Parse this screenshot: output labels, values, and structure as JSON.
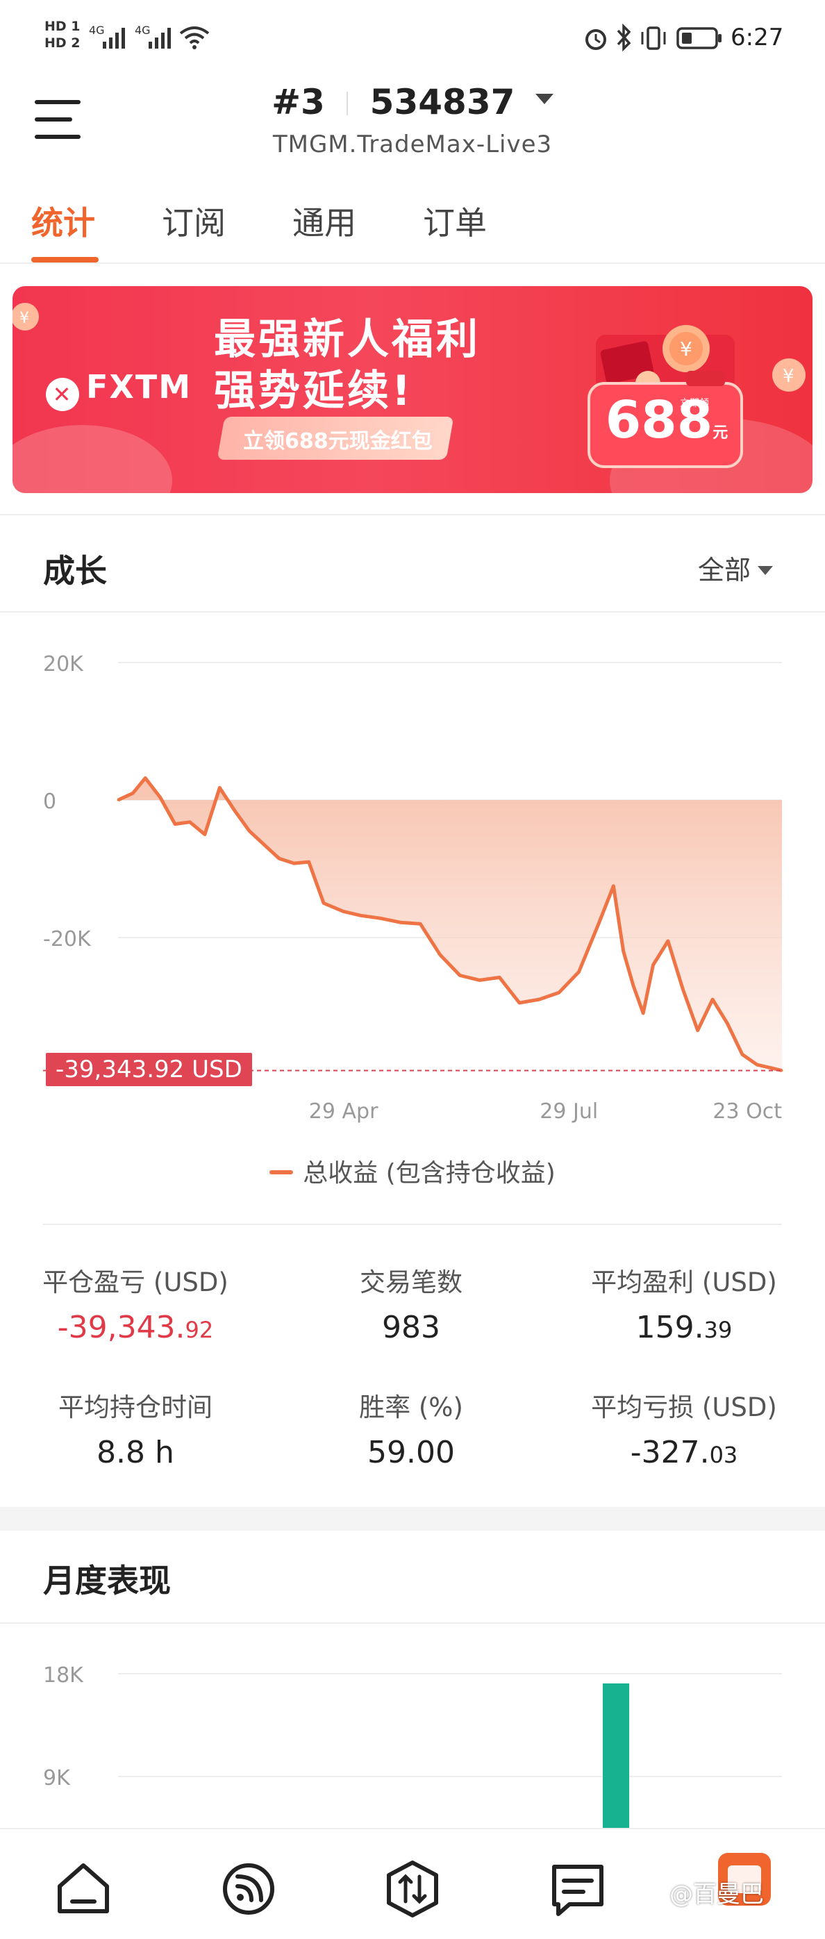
{
  "status_bar": {
    "sim1": "HD 1",
    "sim2": "HD 2",
    "net1": "4G",
    "net2": "4G",
    "time": "6:27"
  },
  "header": {
    "account_prefix": "#3",
    "account_id": "534837",
    "server": "TMGM.TradeMax-Live3",
    "menu_icon": "hamburger-menu-icon",
    "dropdown_icon": "caret-down-icon"
  },
  "tabs": [
    {
      "label": "统计",
      "active": true
    },
    {
      "label": "订阅",
      "active": false
    },
    {
      "label": "通用",
      "active": false
    },
    {
      "label": "订单",
      "active": false
    }
  ],
  "banner": {
    "brand": "FXTM",
    "line1": "最强新人福利",
    "line2": "强势延续!",
    "pill_text": "立领688元现金红包",
    "gift_amount": "688",
    "gift_unit": "元",
    "gift_tag": "立即领",
    "colors": {
      "bg": "#f2364f",
      "text": "#ffffff"
    }
  },
  "growth": {
    "title": "成长",
    "filter": "全部",
    "current_value_label": "-39,343.92 USD",
    "legend": "总收益 (包含持仓收益)"
  },
  "chart_data": {
    "type": "area",
    "ylim": [
      -39344,
      20000
    ],
    "y_ticks": [
      "20K",
      "0",
      "-20K"
    ],
    "y_tick_values": [
      20000,
      0,
      -20000
    ],
    "x_tick_labels": [
      "29 Apr",
      "29 Jul",
      "23 Oct"
    ],
    "x": [
      "2024-01-29",
      "2024-02-04",
      "2024-02-09",
      "2024-02-15",
      "2024-02-21",
      "2024-02-27",
      "2024-03-04",
      "2024-03-10",
      "2024-03-16",
      "2024-03-22",
      "2024-03-28",
      "2024-04-03",
      "2024-04-09",
      "2024-04-15",
      "2024-04-21",
      "2024-04-29",
      "2024-05-06",
      "2024-05-14",
      "2024-05-22",
      "2024-05-30",
      "2024-06-07",
      "2024-06-15",
      "2024-06-23",
      "2024-07-01",
      "2024-07-09",
      "2024-07-17",
      "2024-07-25",
      "2024-08-02",
      "2024-08-10",
      "2024-08-16",
      "2024-08-20",
      "2024-08-24",
      "2024-08-28",
      "2024-09-01",
      "2024-09-07",
      "2024-09-13",
      "2024-09-19",
      "2024-09-25",
      "2024-10-01",
      "2024-10-07",
      "2024-10-13",
      "2024-10-19",
      "2024-10-23"
    ],
    "series": [
      {
        "values": [
          0,
          1000,
          3200,
          400,
          -3500,
          -3200,
          -5000,
          1800,
          -1500,
          -4500,
          -6500,
          -8500,
          -9200,
          -9000,
          -15000,
          -16200,
          -16800,
          -17200,
          -17800,
          -18000,
          -22500,
          -25500,
          -26200,
          -25800,
          -29500,
          -29000,
          -28000,
          -25000,
          -18000,
          -12500,
          -22000,
          -27000,
          -31000,
          -24000,
          -20500,
          -27500,
          -33500,
          -29000,
          -32500,
          -37000,
          -38500,
          -39000,
          -39344
        ],
        "color": "#ef7445"
      }
    ],
    "grid": true
  },
  "stats": [
    {
      "label": "平仓盈亏 (USD)",
      "value": "-39,343.",
      "decimals": "92",
      "negative": true
    },
    {
      "label": "交易笔数",
      "value": "983",
      "decimals": "",
      "negative": false
    },
    {
      "label": "平均盈利 (USD)",
      "value": "159.",
      "decimals": "39",
      "negative": false
    },
    {
      "label": "平均持仓时间",
      "value": "8.8 h",
      "decimals": "",
      "negative": false
    },
    {
      "label": "胜率 (%)",
      "value": "59.00",
      "decimals": "",
      "negative": false
    },
    {
      "label": "平均亏损 (USD)",
      "value": "-327.",
      "decimals": "03",
      "negative": false
    }
  ],
  "monthly": {
    "title": "月度表现",
    "y_ticks": [
      "18K",
      "9K"
    ],
    "bar_color": "#17b391"
  },
  "bottom_nav": [
    {
      "icon": "home-icon"
    },
    {
      "icon": "signal-feed-icon"
    },
    {
      "icon": "trade-arrows-icon"
    },
    {
      "icon": "message-list-icon"
    },
    {
      "icon": "promo-icon"
    }
  ],
  "watermark": "@百曼巴"
}
